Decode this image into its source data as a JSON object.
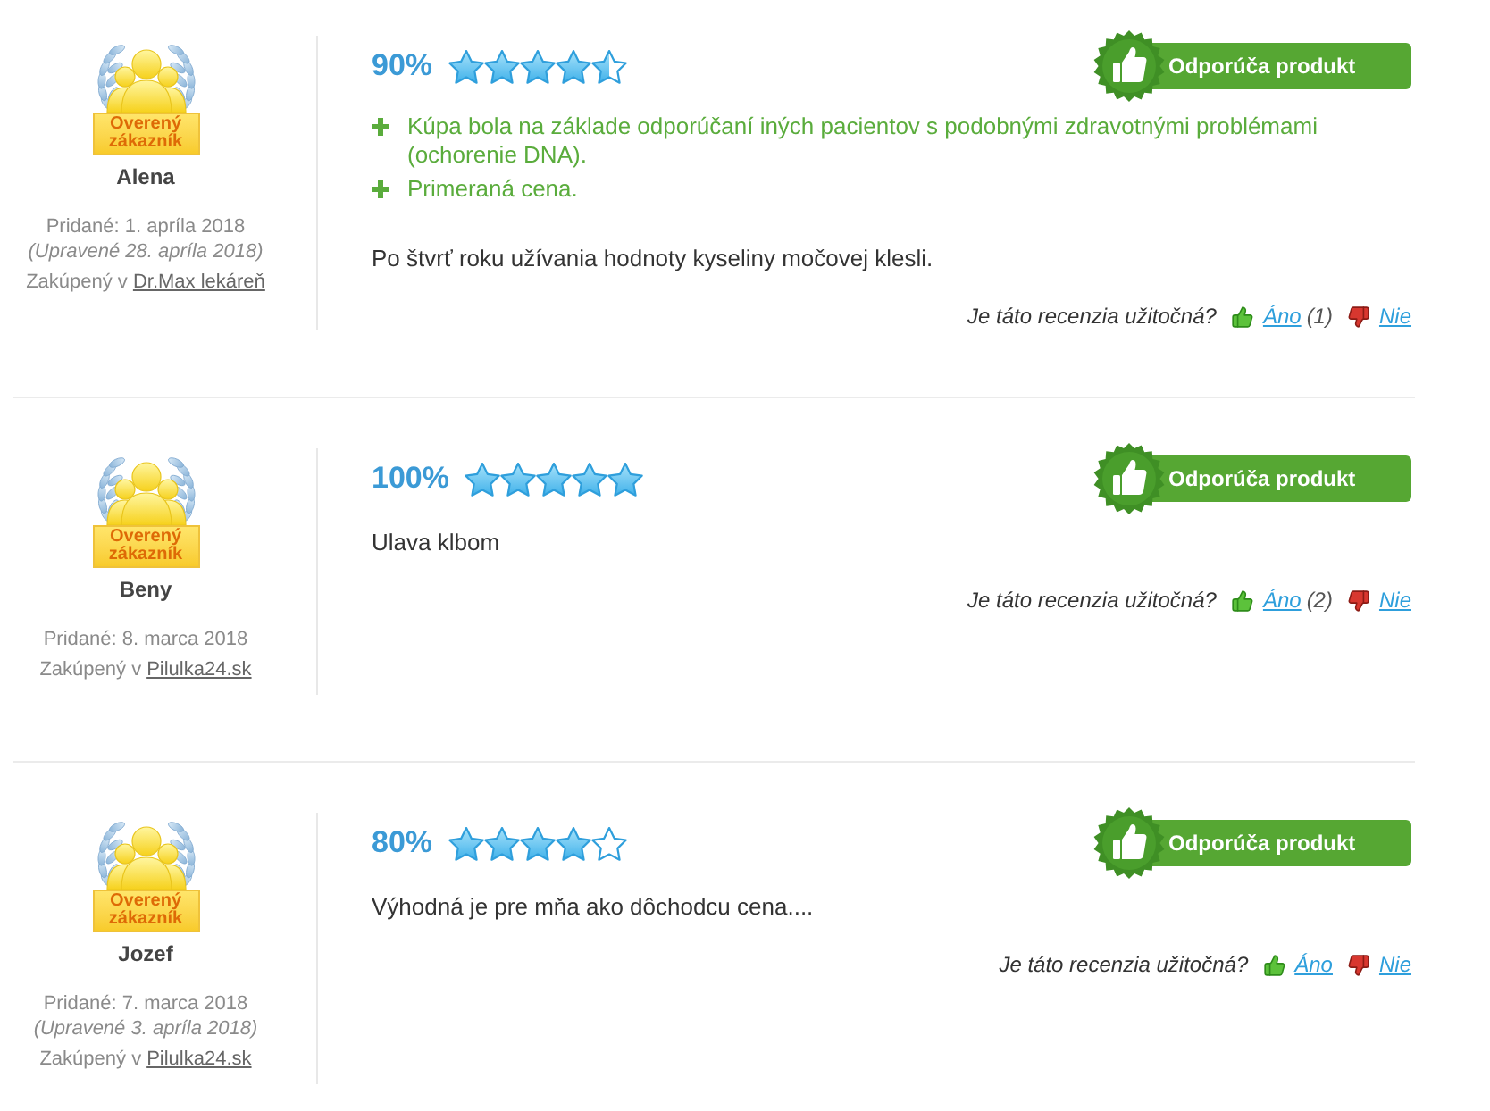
{
  "reviews": [
    {
      "author": {
        "badge": "Overený zákazník",
        "name": "Alena"
      },
      "added": "Pridané: 1. apríla 2018",
      "edited": "(Upravené 28. apríla 2018)",
      "purchase": {
        "prefix": "Zakúpený v",
        "store": "Dr.Max lekáreň"
      },
      "rating": {
        "percent": "90%",
        "stars": 4.5
      },
      "recommendation": {
        "recommended": true,
        "label": "Odporúča produkt"
      },
      "pros": [
        "Kúpa bola na základe odporúčaní iných pacientov s podobnými zdravotnými problémami (ochorenie DNA).",
        "Primeraná cena."
      ],
      "text": "Po štvrť roku užívania hodnoty kyseliny močovej klesli.",
      "helpful": {
        "question": "Je táto recenzia užitočná?",
        "yes": "Áno",
        "yes_count": "(1)",
        "no": "Nie"
      }
    },
    {
      "author": {
        "badge": "Overený zákazník",
        "name": "Beny"
      },
      "added": "Pridané: 8. marca 2018",
      "purchase": {
        "prefix": "Zakúpený v",
        "store": "Pilulka24.sk"
      },
      "rating": {
        "percent": "100%",
        "stars": 5
      },
      "recommendation": {
        "recommended": true,
        "label": "Odporúča produkt"
      },
      "text": "Ulava klbom",
      "helpful": {
        "question": "Je táto recenzia užitočná?",
        "yes": "Áno",
        "yes_count": "(2)",
        "no": "Nie"
      }
    },
    {
      "author": {
        "badge": "Overený zákazník",
        "name": "Jozef"
      },
      "added": "Pridané: 7. marca 2018",
      "edited": "(Upravené 3. apríla 2018)",
      "purchase": {
        "prefix": "Zakúpený v",
        "store": "Pilulka24.sk"
      },
      "rating": {
        "percent": "80%",
        "stars": 4
      },
      "recommendation": {
        "recommended": true,
        "label": "Odporúča produkt"
      },
      "text": "Výhodná je pre mňa ako dôchodcu cena....",
      "helpful": {
        "question": "Je táto recenzia užitočná?",
        "yes": "Áno",
        "no": "Nie"
      }
    }
  ]
}
